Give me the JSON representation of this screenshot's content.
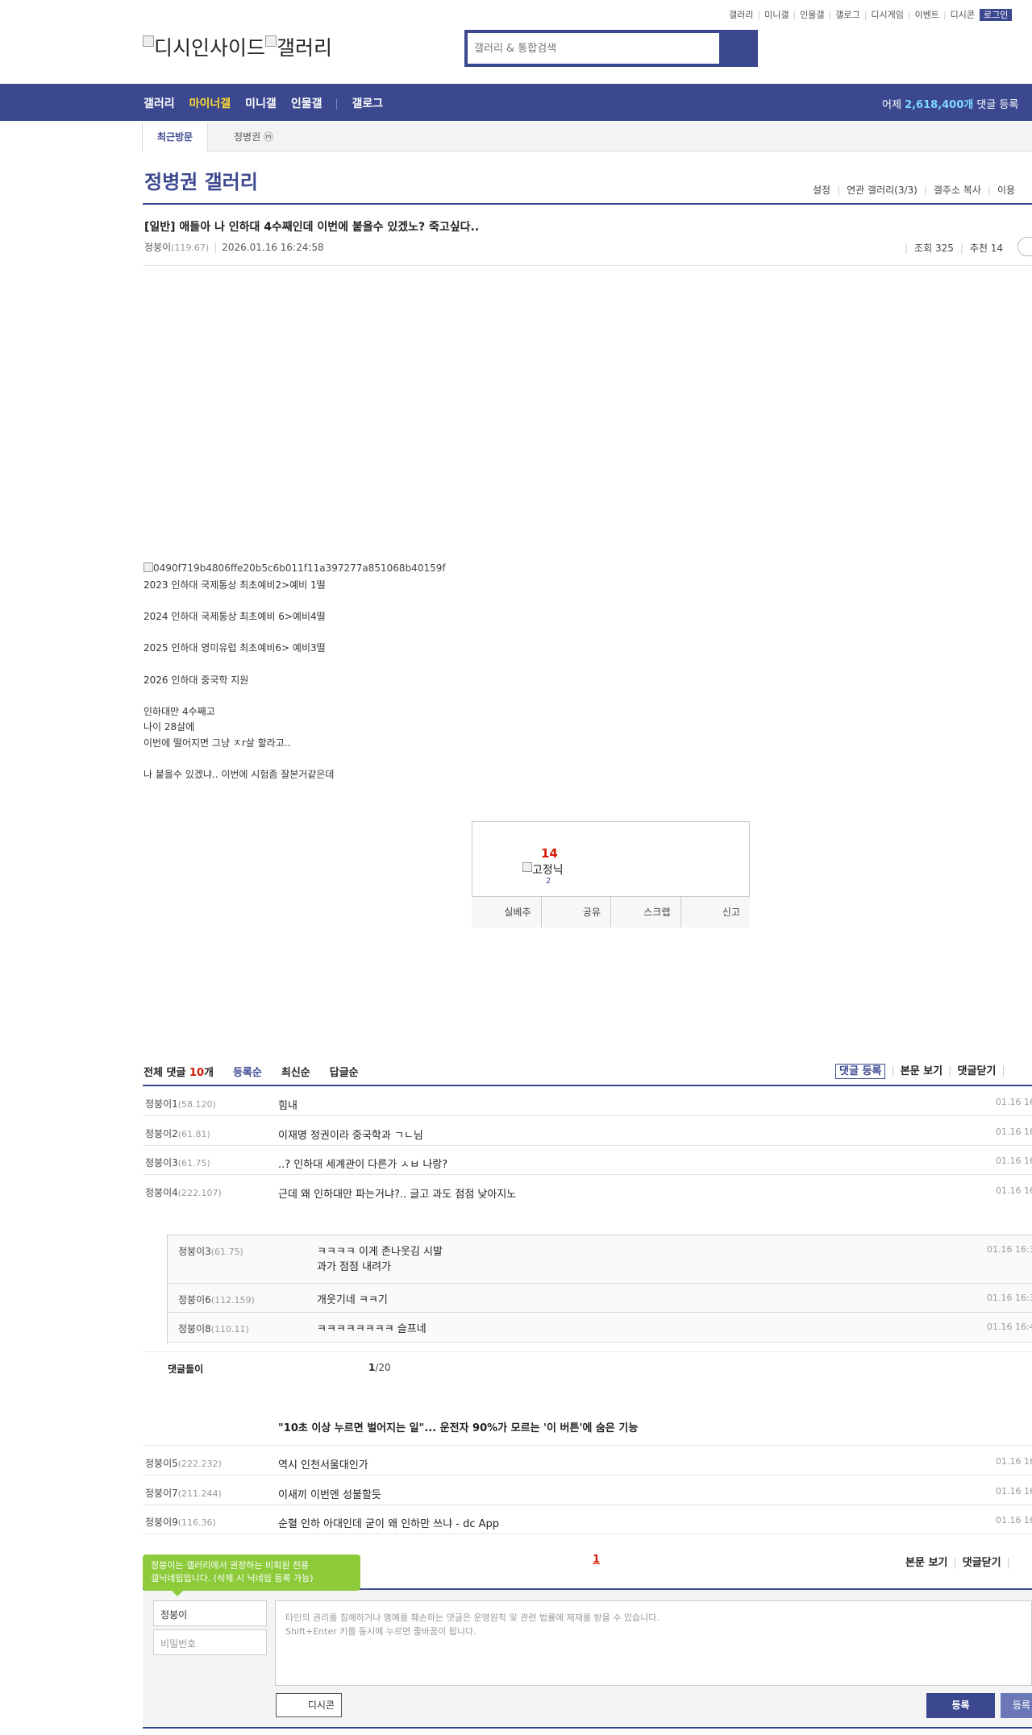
{
  "top_links": [
    "갤러리",
    "미니갤",
    "인물갤",
    "갤로그",
    "디시게임",
    "이벤트",
    "디시콘"
  ],
  "login_label": "로그인",
  "logo_text": "디시인사이드",
  "logo_text2": "갤러리",
  "search_placeholder": "갤러리 & 통합검색",
  "nav": {
    "items": [
      "갤러리",
      "마이너갤",
      "미니갤",
      "인물갤",
      "갤로그"
    ],
    "active": "마이너갤",
    "right_prefix": "어제 ",
    "right_count": "2,618,400개",
    "right_suffix": " 댓글 등록"
  },
  "visited": {
    "label": "최근방문",
    "item": "정병권 ⓜ"
  },
  "gallery": {
    "title": "정병권 갤러리",
    "tools": [
      "설정",
      "연관 갤러리(3/3)",
      "갤주소 복사",
      "이용"
    ]
  },
  "post": {
    "title": "[일반] 애들아 나 인하대 4수째인데 이번에 붙을수 있겠노? 죽고싶다..",
    "author": "정붕이",
    "author_ip": "(119.67)",
    "date": "2026.01.16 16:24:58",
    "views": "조회 325",
    "recommend": "추천 14",
    "image_alt": "0490f719b4806ffe20b5c6b011f11a397277a851068b40159f",
    "body": "2023 인하대 국제통상 최초예비2>예비 1떨\n\n2024 인하대 국제통상 최초예비 6>예비4떨\n\n2025 인하대 영미유럽 최초예비6> 예비3떨\n\n2026 인하대 중국학 지원\n\n인하대만 4수째고\n나이 28살에\n이번에 떨어지면 그냥 ㅈr살 할라고..\n\n나 붙을수 있겠냐.. 이번에 시험좀 잘본거같은데"
  },
  "recommend_box": {
    "count": "14",
    "fixed_nick": "고정닉",
    "fixed_count": "2",
    "buttons": [
      "실베추",
      "공유",
      "스크랩",
      "신고"
    ]
  },
  "comments_header": {
    "total_prefix": "전체 댓글 ",
    "total_count": "10",
    "total_suffix": "개",
    "sorts": [
      "등록순",
      "최신순",
      "답글순"
    ],
    "actions": [
      "댓글 등록",
      "본문 보기",
      "댓글닫기"
    ]
  },
  "comments": [
    {
      "nick": "정붕이1",
      "ip": "(58.120)",
      "text": "힘내",
      "date": "01.16 16"
    },
    {
      "nick": "정붕이2",
      "ip": "(61.81)",
      "text": "이재명 정권이라 중국학과 ㄱㄴ님",
      "date": "01.16 16"
    },
    {
      "nick": "정붕이3",
      "ip": "(61.75)",
      "text": "..? 인하대 세계관이 다른가 ㅅㅂ 나랑?",
      "date": "01.16 16"
    },
    {
      "nick": "정붕이4",
      "ip": "(222.107)",
      "text": "근데 왜 인하대만 파는거냐?.. 글고 과도 점점 낮아지노",
      "date": "01.16 16"
    }
  ],
  "replies": [
    {
      "nick": "정붕이3",
      "ip": "(61.75)",
      "text": "ㅋㅋㅋㅋ 이게 존나웃김 시발\n과가 점점 내려가",
      "date": "01.16 16:3"
    },
    {
      "nick": "정붕이6",
      "ip": "(112.159)",
      "text": "개웃기네 ㅋㅋ기",
      "date": "01.16 16:3"
    },
    {
      "nick": "정붕이8",
      "ip": "(110.11)",
      "text": "ㅋㅋㅋㅋㅋㅋㅋㅋ 슬프네",
      "date": "01.16 16:4"
    }
  ],
  "dolly": {
    "label": "댓글돌이",
    "page_current": "1",
    "page_total": "/20"
  },
  "ad_text": "\"10초 이상 누르면 벌어지는 일\"... 운전자 90%가 모르는 '이 버튼'에 숨은 기능",
  "comments2": [
    {
      "nick": "정붕이5",
      "ip": "(222.232)",
      "text": "역시 인천서울대인가",
      "date": "01.16 16"
    },
    {
      "nick": "정붕이7",
      "ip": "(211.244)",
      "text": "이새끼 이번엔 성불할듯",
      "date": "01.16 16"
    },
    {
      "nick": "정붕이9",
      "ip": "(116.36)",
      "text": "순혈 인하 아대인데 굳이 왜 인하만 쓰냐 - dc App",
      "date": "01.16 16"
    }
  ],
  "pager": {
    "current": "1",
    "actions": [
      "본문 보기",
      "댓글닫기"
    ]
  },
  "write": {
    "tooltip": "정붕이는 갤러리에서 권장하는 비회원 전용\n갤닉네임입니다. (삭제 시 닉네임 등록 가능)",
    "nick_value": "정붕이",
    "pw_placeholder": "비밀번호",
    "textarea_placeholder": "타인의 권리를 침해하거나 명예를 훼손하는 댓글은 운영원칙 및 관련 법률에 제재를 받을 수 있습니다.\nShift+Enter 키를 동시에 누르면 줄바꿈이 됩니다.",
    "dccon_label": "디시콘",
    "submit_label": "등록",
    "submit2_label": "등록"
  },
  "colors": {
    "brand": "#3b4890",
    "accent_yellow": "#ffdc2e",
    "red": "#d31900",
    "tooltip_green": "#8dcb3b"
  }
}
